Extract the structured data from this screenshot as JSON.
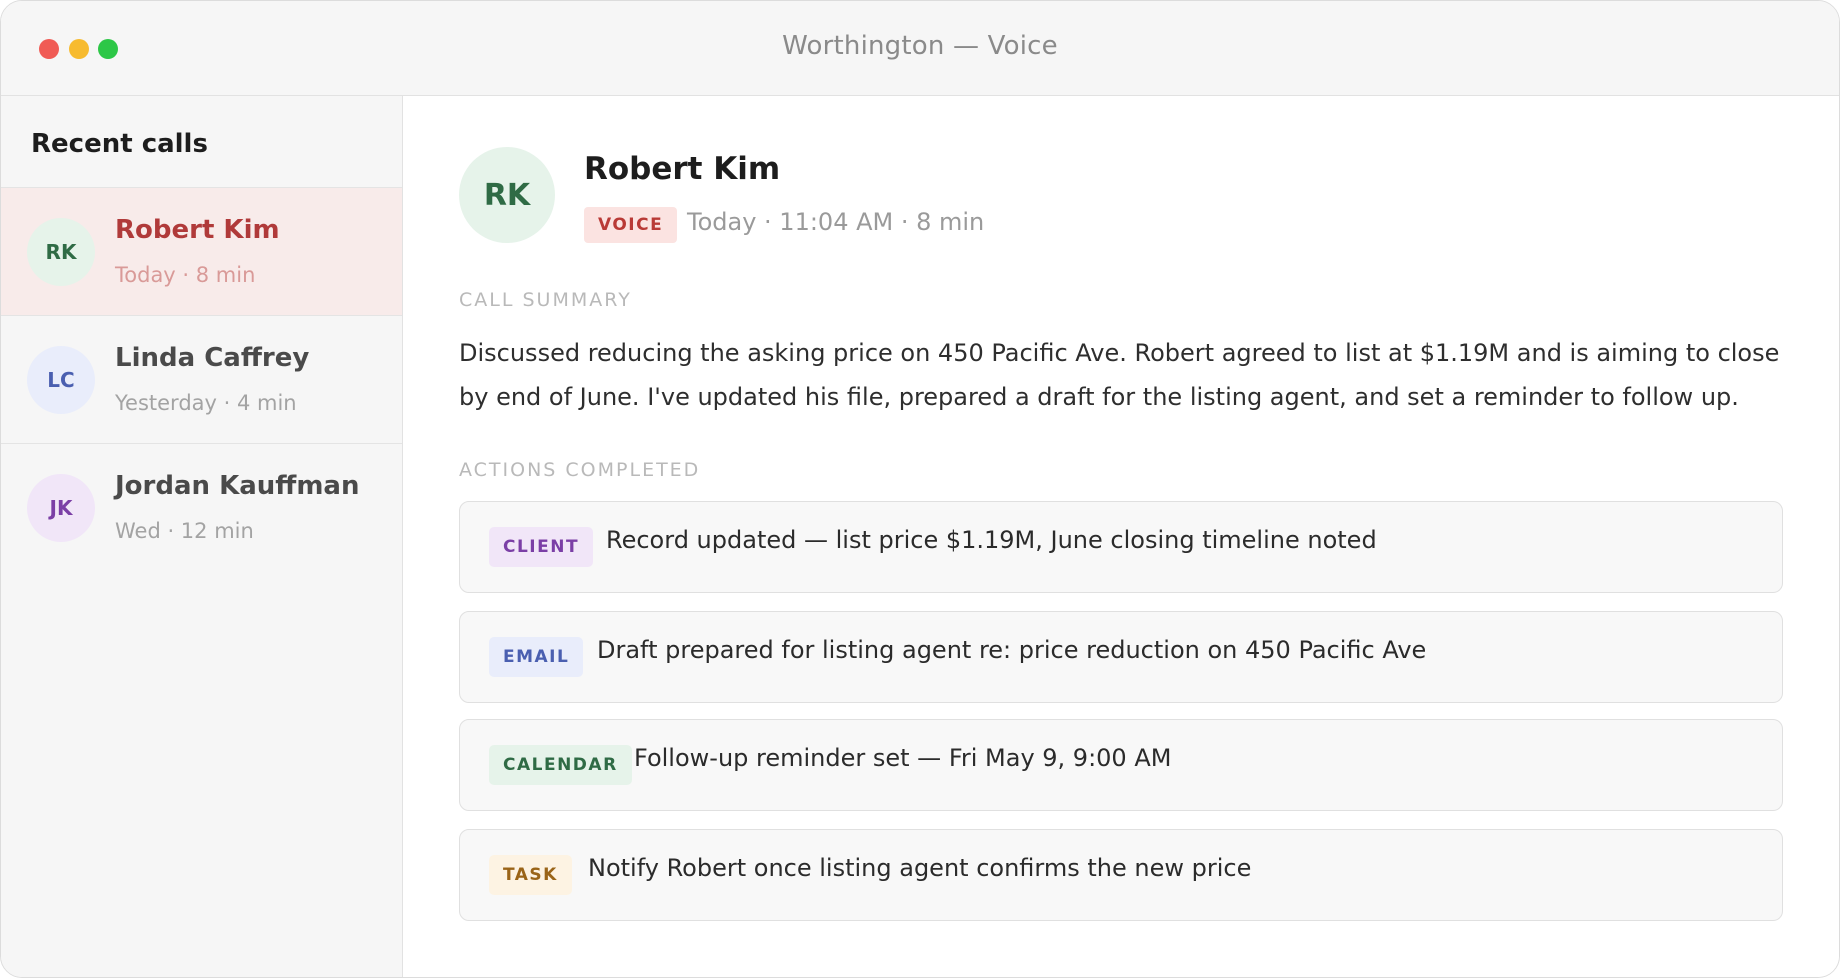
{
  "window": {
    "title": "Worthington — Voice"
  },
  "sidebar": {
    "heading": "Recent calls",
    "calls": [
      {
        "initials": "RK",
        "name": "Robert Kim",
        "meta": "Today · 8 min",
        "avatar_bg": "#e6f3ea",
        "avatar_fg": "#2f6b45",
        "active": true
      },
      {
        "initials": "LC",
        "name": "Linda Caffrey",
        "meta": "Yesterday · 4 min",
        "avatar_bg": "#e9edfb",
        "avatar_fg": "#4a5fb0",
        "active": false
      },
      {
        "initials": "JK",
        "name": "Jordan Kauffman",
        "meta": "Wed · 12 min",
        "avatar_bg": "#f1e6f8",
        "avatar_fg": "#7b3fa6",
        "active": false
      }
    ]
  },
  "detail": {
    "initials": "RK",
    "name": "Robert Kim",
    "badge": "VOICE",
    "meta": "Today · 11:04 AM · 8 min",
    "summary_label": "CALL SUMMARY",
    "summary": "Discussed reducing the asking price on 450 Pacific Ave. Robert agreed to list at $1.19M and is aiming to close by end of June. I've updated his file, prepared a draft for the listing agent, and set a reminder to follow up.",
    "actions_label": "ACTIONS COMPLETED",
    "actions": [
      {
        "tag": "CLIENT",
        "text": "Record updated — list price $1.19M, June closing timeline noted",
        "tag_bg": "#f1e6f8",
        "tag_fg": "#7b3fa6"
      },
      {
        "tag": "EMAIL",
        "text": "Draft prepared for listing agent re: price reduction on 450 Pacific Ave",
        "tag_bg": "#e9edfb",
        "tag_fg": "#4a5fb0"
      },
      {
        "tag": "CALENDAR",
        "text": "Follow-up reminder set — Fri May 9, 9:00 AM",
        "tag_bg": "#e6f3ea",
        "tag_fg": "#2f6b45"
      },
      {
        "tag": "TASK",
        "text": "Notify Robert once listing agent confirms the new price",
        "tag_bg": "#fdf3e3",
        "tag_fg": "#9a6418"
      }
    ]
  }
}
